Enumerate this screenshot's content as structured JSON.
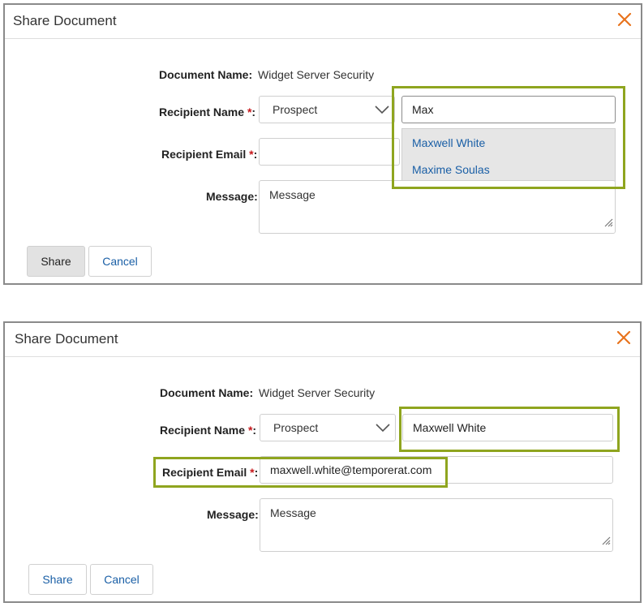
{
  "panel1": {
    "title": "Share Document",
    "doc_name_label": "Document Name:",
    "doc_name_value": "Widget Server Security",
    "recipient_name_label": "Recipient Name",
    "recipient_type": "Prospect",
    "recipient_name_value": "Max",
    "suggestions": [
      "Maxwell White",
      "Maxime Soulas"
    ],
    "recipient_email_label": "Recipient Email",
    "recipient_email_value": "",
    "message_label": "Message:",
    "message_placeholder": "Message",
    "share_label": "Share",
    "cancel_label": "Cancel"
  },
  "panel2": {
    "title": "Share Document",
    "doc_name_label": "Document Name:",
    "doc_name_value": "Widget Server Security",
    "recipient_name_label": "Recipient Name",
    "recipient_type": "Prospect",
    "recipient_name_value": "Maxwell White",
    "recipient_email_label": "Recipient Email",
    "recipient_email_value": "maxwell.white@temporerat.com",
    "message_label": "Message:",
    "message_placeholder": "Message",
    "share_label": "Share",
    "cancel_label": "Cancel"
  },
  "required_marker": "*",
  "field_suffix": ":",
  "colors": {
    "highlight": "#8fa51f",
    "close_icon": "#e8731c",
    "link": "#1a5fa6",
    "required": "#c6161a"
  },
  "icons": {
    "close": "close-icon",
    "chevron": "chevron-down-icon",
    "grip": "resize-grip-icon"
  }
}
